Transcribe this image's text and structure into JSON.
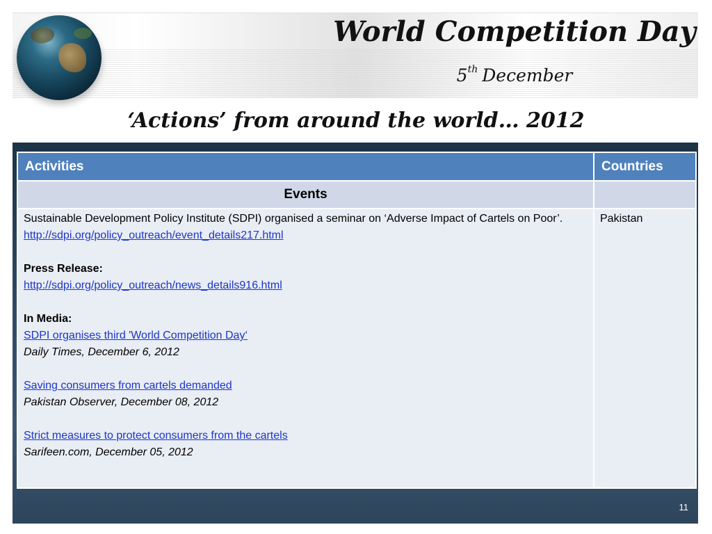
{
  "header": {
    "title": "World Competition Day",
    "date_day": "5",
    "date_suffix": "th",
    "date_month": "December",
    "subtitle": "‘Actions’ from around the world… 2012"
  },
  "table": {
    "columns": [
      "Activities",
      "Countries"
    ],
    "section_label": "Events",
    "row": {
      "country": "Pakistan",
      "intro": "Sustainable Development Policy Institute (SDPI) organised a seminar on ‘Adverse Impact of Cartels on Poor’.",
      "intro_link": "http://sdpi.org/policy_outreach/event_details217.html",
      "press_label": "Press Release:",
      "press_link": "http://sdpi.org/policy_outreach/news_details916.html",
      "media_label": "In Media:",
      "media": [
        {
          "title": "SDPI organises third 'World Competition Day‘",
          "source": "Daily Times, December 6, 2012"
        },
        {
          "title": "Saving consumers from cartels demanded",
          "source": "Pakistan Observer, December 08, 2012"
        },
        {
          "title": "Strict measures to protect consumers from the cartels",
          "source": "Sarifeen.com, December 05, 2012"
        }
      ]
    }
  },
  "page_number": "11",
  "colors": {
    "header_blue": "#4f81bd",
    "link_blue": "#1a36c8",
    "panel_dark": "#2f4b63"
  }
}
